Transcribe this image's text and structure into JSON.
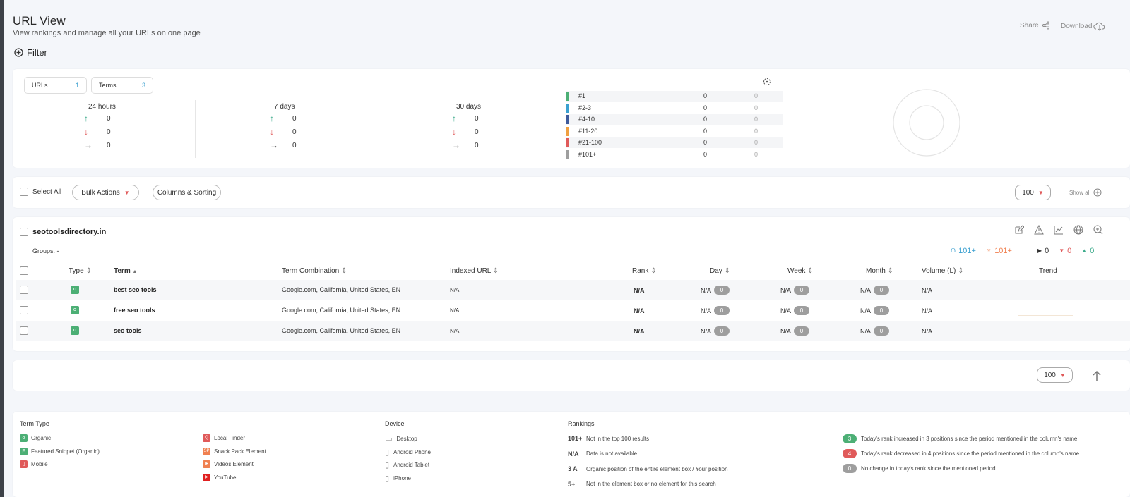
{
  "header": {
    "title": "URL View",
    "subtitle": "View rankings and manage all your URLs on one page",
    "share": "Share",
    "download": "Download",
    "filter": "Filter"
  },
  "summary": {
    "urls_label": "URLs",
    "urls_count": "1",
    "terms_label": "Terms",
    "terms_count": "3",
    "periods": [
      {
        "label": "24 hours",
        "up": "0",
        "down": "0",
        "same": "0"
      },
      {
        "label": "7 days",
        "up": "0",
        "down": "0",
        "same": "0"
      },
      {
        "label": "30 days",
        "up": "0",
        "down": "0",
        "same": "0"
      }
    ],
    "ranks": [
      {
        "label": "#1",
        "v1": "0",
        "v2": "0",
        "color": "#4caf75"
      },
      {
        "label": "#2-3",
        "v1": "0",
        "v2": "0",
        "color": "#3aa0d0"
      },
      {
        "label": "#4-10",
        "v1": "0",
        "v2": "0",
        "color": "#3d5a9c"
      },
      {
        "label": "#11-20",
        "v1": "0",
        "v2": "0",
        "color": "#f0a040"
      },
      {
        "label": "#21-100",
        "v1": "0",
        "v2": "0",
        "color": "#e05a5a"
      },
      {
        "label": "#101+",
        "v1": "0",
        "v2": "0",
        "color": "#9e9e9e"
      }
    ]
  },
  "toolbar": {
    "select_all": "Select All",
    "bulk_actions": "Bulk Actions",
    "columns_sorting": "Columns & Sorting",
    "per_page": "100",
    "show_all": "Show all"
  },
  "domain": {
    "name": "seotoolsdirectory.in",
    "groups": "Groups: -",
    "stat_a": "101+",
    "stat_b": "101+",
    "stat_c": "0",
    "stat_d": "0",
    "stat_e": "0"
  },
  "columns": {
    "type": "Type",
    "term": "Term",
    "combo": "Term Combination",
    "indexed": "Indexed URL",
    "rank": "Rank",
    "day": "Day",
    "week": "Week",
    "month": "Month",
    "volume": "Volume (L)",
    "trend": "Trend"
  },
  "rows": [
    {
      "type": "o",
      "term": "best seo tools",
      "combo": "Google.com, California, United States, EN",
      "indexed": "N/A",
      "rank": "N/A",
      "day": "N/A",
      "day_c": "0",
      "week": "N/A",
      "week_c": "0",
      "month": "N/A",
      "month_c": "0",
      "volume": "N/A"
    },
    {
      "type": "o",
      "term": "free seo tools",
      "combo": "Google.com, California, United States, EN",
      "indexed": "N/A",
      "rank": "N/A",
      "day": "N/A",
      "day_c": "0",
      "week": "N/A",
      "week_c": "0",
      "month": "N/A",
      "month_c": "0",
      "volume": "N/A"
    },
    {
      "type": "o",
      "term": "seo tools",
      "combo": "Google.com, California, United States, EN",
      "indexed": "N/A",
      "rank": "N/A",
      "day": "N/A",
      "day_c": "0",
      "week": "N/A",
      "week_c": "0",
      "month": "N/A",
      "month_c": "0",
      "volume": "N/A"
    }
  ],
  "footer_pager": {
    "per_page": "100"
  },
  "legend": {
    "term_type_title": "Term Type",
    "term_types": [
      {
        "label": "Organic",
        "color": "#4caf75",
        "glyph": "o"
      },
      {
        "label": "Featured Snippet (Organic)",
        "color": "#4caf75",
        "glyph": "F"
      },
      {
        "label": "Mobile",
        "color": "#e05a5a",
        "glyph": "▯"
      }
    ],
    "term_types2": [
      {
        "label": "Local Finder",
        "color": "#e05a5a",
        "glyph": "Q"
      },
      {
        "label": "Snack Pack Element",
        "color": "#f08050",
        "glyph": "SP"
      },
      {
        "label": "Videos Element",
        "color": "#f08050",
        "glyph": "▶"
      },
      {
        "label": "YouTube",
        "color": "#e02020",
        "glyph": "▶"
      }
    ],
    "device_title": "Device",
    "devices": [
      {
        "label": "Desktop"
      },
      {
        "label": "Android Phone"
      },
      {
        "label": "Android Tablet"
      },
      {
        "label": "iPhone"
      }
    ],
    "rankings_title": "Rankings",
    "rankings": [
      {
        "key": "101+",
        "desc": "Not in the top 100 results"
      },
      {
        "key": "N/A",
        "desc": "Data is not available"
      },
      {
        "key": "3 A",
        "desc": "Organic position of the entire element box / Your position"
      },
      {
        "key": "5+",
        "desc": "Not in the element box or no element for this search"
      }
    ],
    "badges": [
      {
        "val": "3",
        "color": "#4caf75",
        "desc": "Today's rank increased in 3 positions since the period mentioned in the column's name"
      },
      {
        "val": "4",
        "color": "#e05a5a",
        "desc": "Today's rank decreased in 4 positions since the period mentioned in the column's name"
      },
      {
        "val": "0",
        "color": "#9e9e9e",
        "desc": "No change in today's rank since the mentioned period"
      }
    ]
  }
}
